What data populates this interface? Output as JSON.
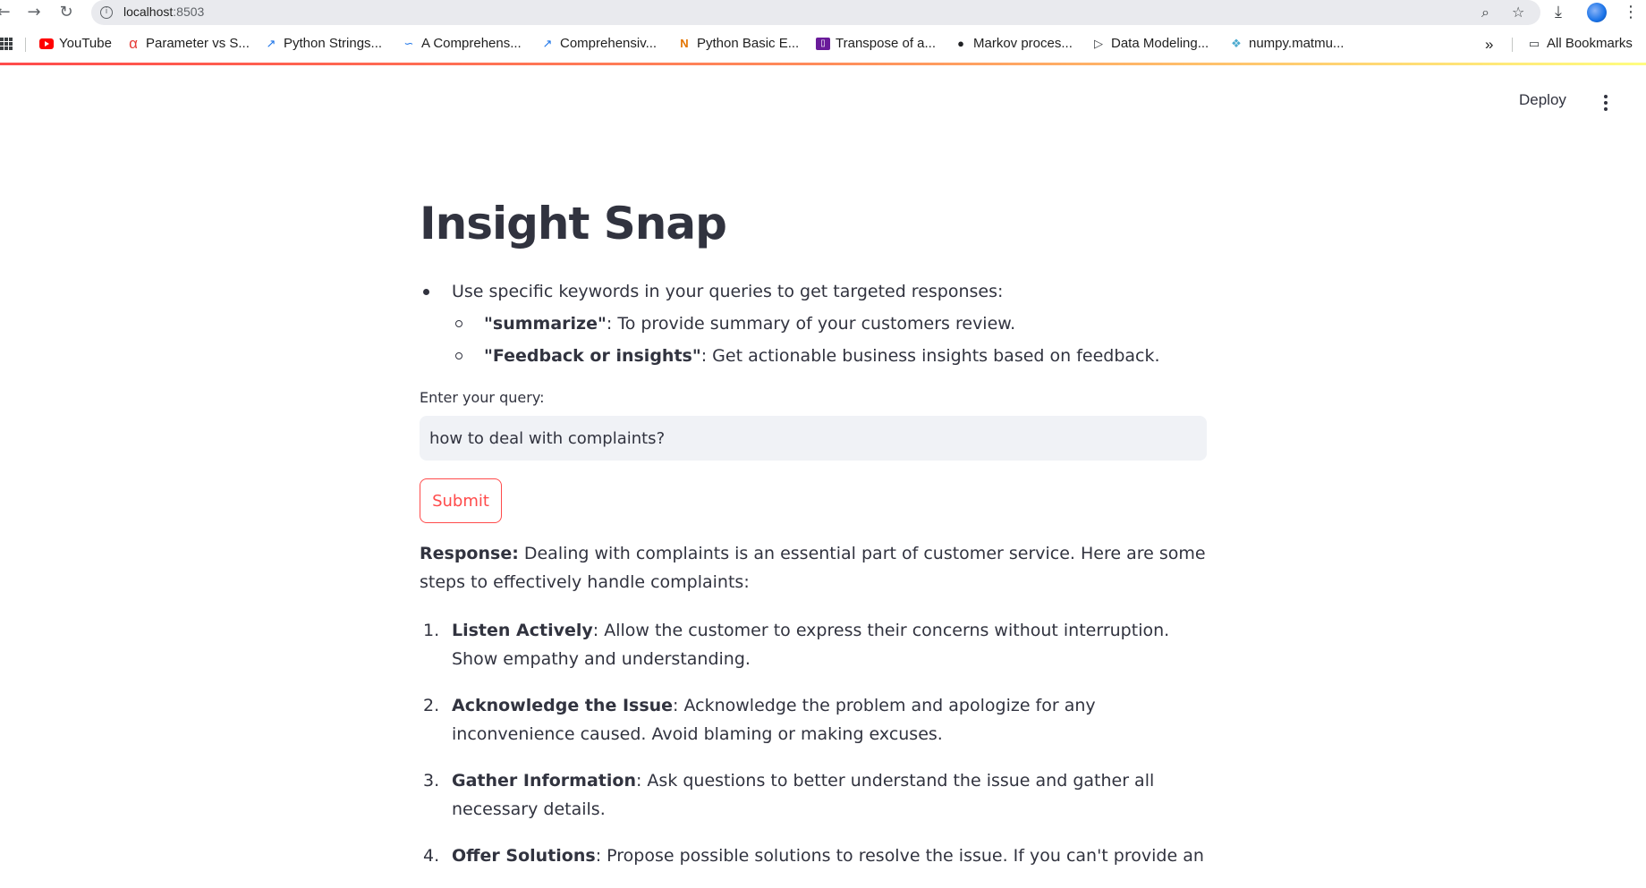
{
  "browser": {
    "url_host": "localhost",
    "url_port": ":8503",
    "bookmarks": [
      {
        "label": "YouTube",
        "icon": "youtube-icon"
      },
      {
        "label": "Parameter vs S...",
        "icon": "alpha-icon"
      },
      {
        "label": "Python Strings...",
        "icon": "chart-line-icon"
      },
      {
        "label": "A Comprehens...",
        "icon": "wave-icon"
      },
      {
        "label": "Comprehensiv...",
        "icon": "chart-line-icon"
      },
      {
        "label": "Python Basic E...",
        "icon": "notebook-icon"
      },
      {
        "label": "Transpose of a...",
        "icon": "bookmark-square-icon"
      },
      {
        "label": "Markov proces...",
        "icon": "globe-icon"
      },
      {
        "label": "Data Modeling...",
        "icon": "play-outline-icon"
      },
      {
        "label": "numpy.matmu...",
        "icon": "numpy-icon"
      }
    ],
    "overflow_label": "»",
    "all_bookmarks_label": "All Bookmarks"
  },
  "header": {
    "deploy_label": "Deploy"
  },
  "main": {
    "title": "Insight Snap",
    "intro_text": "Use specific keywords in your queries to get targeted responses:",
    "keywords": [
      {
        "keyword": "\"summarize\"",
        "description": ": To provide summary of your customers review."
      },
      {
        "keyword": "\"Feedback or insights\"",
        "description": ": Get actionable business insights based on feedback."
      }
    ],
    "query_label": "Enter your query:",
    "query_value": "how to deal with complaints?",
    "submit_label": "Submit",
    "response_label": "Response:",
    "response_intro": " Dealing with complaints is an essential part of customer service. Here are some steps to effectively handle complaints:",
    "steps": [
      {
        "num": "1.",
        "title": "Listen Actively",
        "text": ": Allow the customer to express their concerns without interruption. Show empathy and understanding."
      },
      {
        "num": "2.",
        "title": "Acknowledge the Issue",
        "text": ": Acknowledge the problem and apologize for any inconvenience caused. Avoid blaming or making excuses."
      },
      {
        "num": "3.",
        "title": "Gather Information",
        "text": ": Ask questions to better understand the issue and gather all necessary details."
      },
      {
        "num": "4.",
        "title": "Offer Solutions",
        "text": ": Propose possible solutions to resolve the issue. If you can't provide an"
      }
    ]
  },
  "colors": {
    "accent": "#ff4b4b",
    "text": "#31333f",
    "input_bg": "#f0f2f6"
  }
}
